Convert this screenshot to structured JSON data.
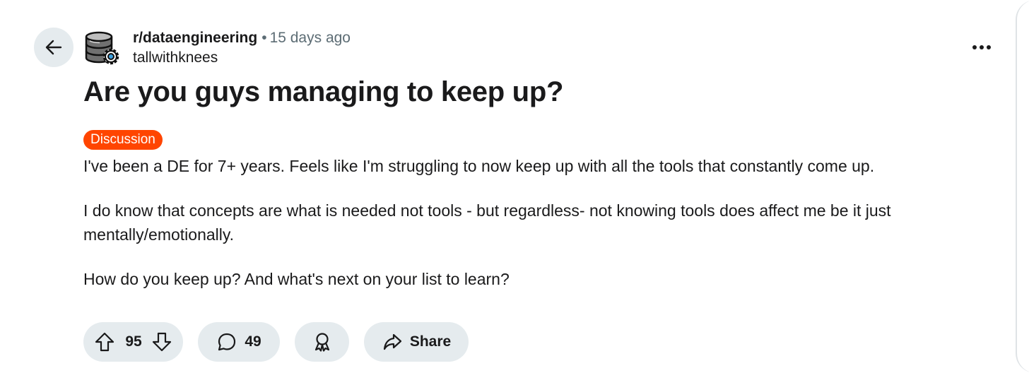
{
  "post": {
    "subreddit": "r/dataengineering",
    "separator": "•",
    "time_ago": "15 days ago",
    "author": "tallwithknees",
    "title": "Are you guys managing to keep up?",
    "flair": "Discussion",
    "body": [
      "I've been a DE for 7+ years. Feels like I'm struggling to now keep up with all the tools that constantly come up.",
      "I do know that concepts are what is needed not tools - but regardless- not knowing tools does affect me be it just mentally/emotionally.",
      "How do you keep up? And what's next on your list to learn?"
    ]
  },
  "actions": {
    "score": "95",
    "comments": "49",
    "share_label": "Share"
  },
  "icons": {
    "back": "arrow-left-icon",
    "subreddit_avatar": "database-gear-icon",
    "more": "ellipsis-icon",
    "upvote": "arrow-up-icon",
    "downvote": "arrow-down-icon",
    "comment": "speech-bubble-icon",
    "award": "award-ribbon-icon",
    "share": "share-arrow-icon"
  },
  "colors": {
    "flair_bg": "#ff4500",
    "pill_bg": "#e5ebee",
    "muted_text": "#5c6c74",
    "text": "#1a1a1b"
  }
}
